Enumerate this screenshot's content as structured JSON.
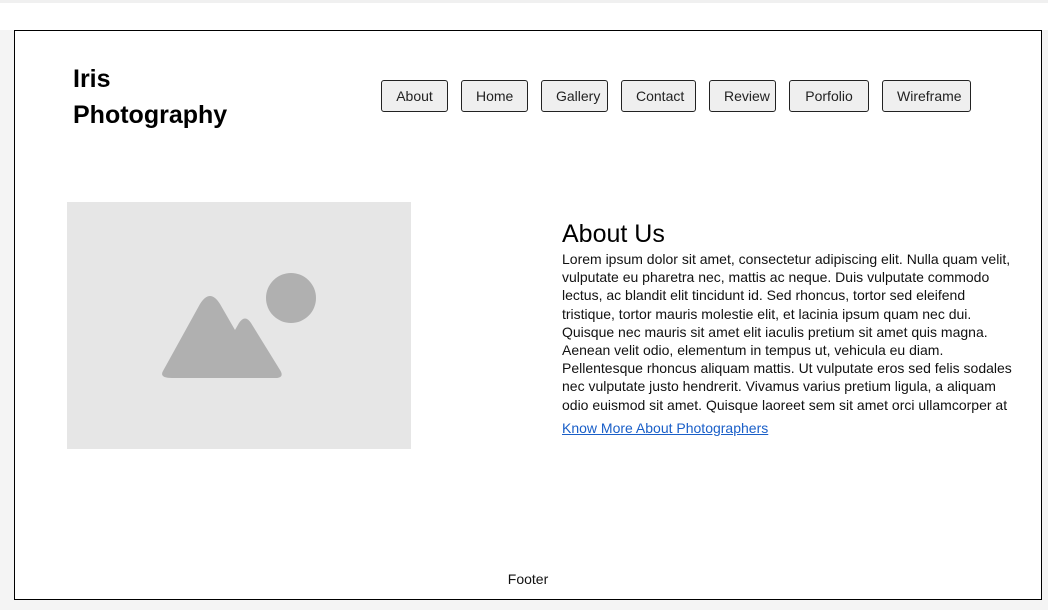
{
  "header": {
    "brand_line1": "Iris",
    "brand_line2": "Photography"
  },
  "nav": {
    "items": [
      {
        "label": "About"
      },
      {
        "label": "Home"
      },
      {
        "label": "Gallery"
      },
      {
        "label": "Contact"
      },
      {
        "label": "Review"
      },
      {
        "label": "Porfolio"
      },
      {
        "label": "Wireframe"
      }
    ]
  },
  "hero": {
    "image_icon": "image-placeholder-icon",
    "placeholder_color": "#e6e6e6",
    "icon_color": "#b0b0b0"
  },
  "about": {
    "title": "About Us",
    "body": "Lorem ipsum dolor sit amet, consectetur adipiscing elit. Nulla quam velit, vulputate eu pharetra nec, mattis ac neque. Duis vulputate commodo lectus, ac blandit elit tincidunt id. Sed rhoncus, tortor sed eleifend tristique, tortor mauris molestie elit, et lacinia ipsum quam nec dui. Quisque nec mauris sit amet elit iaculis pretium sit amet quis magna. Aenean velit odio, elementum in tempus ut, vehicula eu diam. Pellentesque rhoncus aliquam mattis. Ut vulputate eros sed felis sodales nec vulputate justo hendrerit. Vivamus varius pretium ligula, a aliquam odio euismod sit amet. Quisque laoreet sem sit amet orci ullamcorper at",
    "link_label": "Know More About Photographers",
    "link_color": "#1a5fc8"
  },
  "footer": {
    "label": "Footer"
  }
}
